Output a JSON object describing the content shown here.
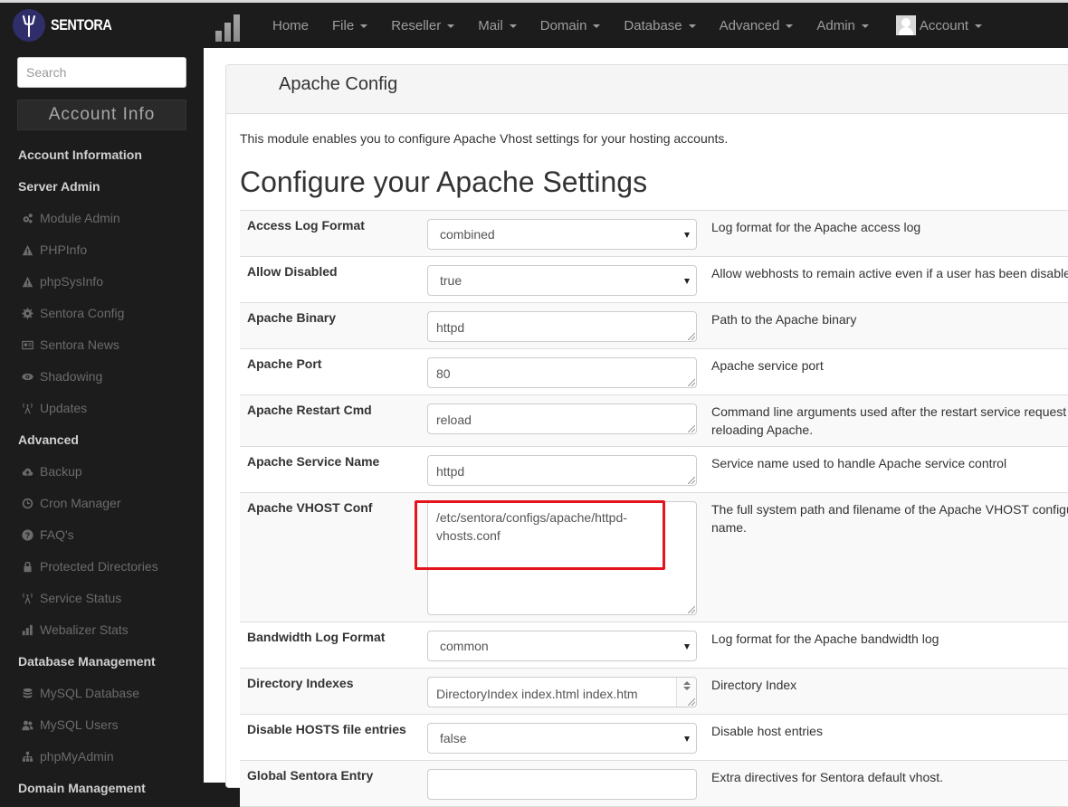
{
  "brand": {
    "name": "SENTORA",
    "accent": "#2f2e6b"
  },
  "nav": {
    "items": [
      {
        "label": "Home",
        "dropdown": false
      },
      {
        "label": "File",
        "dropdown": true
      },
      {
        "label": "Reseller",
        "dropdown": true
      },
      {
        "label": "Mail",
        "dropdown": true
      },
      {
        "label": "Domain",
        "dropdown": true
      },
      {
        "label": "Database",
        "dropdown": true
      },
      {
        "label": "Advanced",
        "dropdown": true
      },
      {
        "label": "Admin",
        "dropdown": true
      }
    ],
    "account_label": "Account"
  },
  "sidebar": {
    "search_placeholder": "Search",
    "account_info_button": "Account Info",
    "sections": [
      {
        "heading": "Account Information",
        "items": []
      },
      {
        "heading": "Server Admin",
        "items": [
          {
            "label": "Module Admin",
            "icon": "cogs-icon"
          },
          {
            "label": "PHPInfo",
            "icon": "warning-icon"
          },
          {
            "label": "phpSysInfo",
            "icon": "warning-icon"
          },
          {
            "label": "Sentora Config",
            "icon": "gear-icon"
          },
          {
            "label": "Sentora News",
            "icon": "newspaper-icon"
          },
          {
            "label": "Shadowing",
            "icon": "eye-icon"
          },
          {
            "label": "Updates",
            "icon": "antenna-icon"
          }
        ]
      },
      {
        "heading": "Advanced",
        "items": [
          {
            "label": "Backup",
            "icon": "cloud-upload-icon"
          },
          {
            "label": "Cron Manager",
            "icon": "clock-icon"
          },
          {
            "label": "FAQ's",
            "icon": "question-icon"
          },
          {
            "label": "Protected Directories",
            "icon": "lock-icon"
          },
          {
            "label": "Service Status",
            "icon": "antenna-icon"
          },
          {
            "label": "Webalizer Stats",
            "icon": "bar-chart-icon"
          }
        ]
      },
      {
        "heading": "Database Management",
        "items": [
          {
            "label": "MySQL Database",
            "icon": "database-icon"
          },
          {
            "label": "MySQL Users",
            "icon": "users-icon"
          },
          {
            "label": "phpMyAdmin",
            "icon": "sitemap-icon"
          }
        ]
      },
      {
        "heading": "Domain Management",
        "items": []
      }
    ]
  },
  "page": {
    "panel_title": "Apache Config",
    "intro": "This module enables you to configure Apache Vhost settings for your hosting accounts.",
    "heading": "Configure your Apache Settings",
    "settings": [
      {
        "label": "Access Log Format",
        "type": "select",
        "value": "combined",
        "description": "Log format for the Apache access log"
      },
      {
        "label": "Allow Disabled",
        "type": "select",
        "value": "true",
        "description": "Allow webhosts to remain active even if a user has been disabled."
      },
      {
        "label": "Apache Binary",
        "type": "textarea",
        "value": "httpd",
        "description": "Path to the Apache binary"
      },
      {
        "label": "Apache Port",
        "type": "textarea",
        "value": "80",
        "description": "Apache service port"
      },
      {
        "label": "Apache Restart Cmd",
        "type": "textarea",
        "value": "reload",
        "description": "Command line arguments used after the restart service request when reloading Apache.",
        "description_line1": "Command line arguments used after the restart service request when",
        "description_line2": "reloading Apache."
      },
      {
        "label": "Apache Service Name",
        "type": "textarea",
        "value": "httpd",
        "description": "Service name used to handle Apache service control"
      },
      {
        "label": "Apache VHOST Conf",
        "type": "textarea",
        "value": "/etc/sentora/configs/apache/httpd-vhosts.conf",
        "value_line1": "/etc/sentora/configs/apache/httpd-",
        "value_line2": "vhosts.conf",
        "description": "The full system path and filename of the Apache VHOST configuration name.",
        "description_line1": "The full system path and filename of the Apache VHOST configuration",
        "description_line2": "name.",
        "highlighted": true
      },
      {
        "label": "Bandwidth Log Format",
        "type": "select",
        "value": "common",
        "description": "Log format for the Apache bandwidth log"
      },
      {
        "label": "Directory Indexes",
        "type": "textarea",
        "value": "DirectoryIndex index.html index.htm index.php index.asp index.aspx index.jsp index.jspa index.shtml index.shtm",
        "value_line1": "DirectoryIndex index.html index.htm",
        "description": "Directory Index"
      },
      {
        "label": "Disable HOSTS file entries",
        "type": "select",
        "value": "false",
        "description": "Disable host entries"
      },
      {
        "label": "Global Sentora Entry",
        "type": "textarea",
        "value": "",
        "description": "Extra directives for Sentora default vhost."
      }
    ],
    "highlight_color": "#e3141b"
  }
}
